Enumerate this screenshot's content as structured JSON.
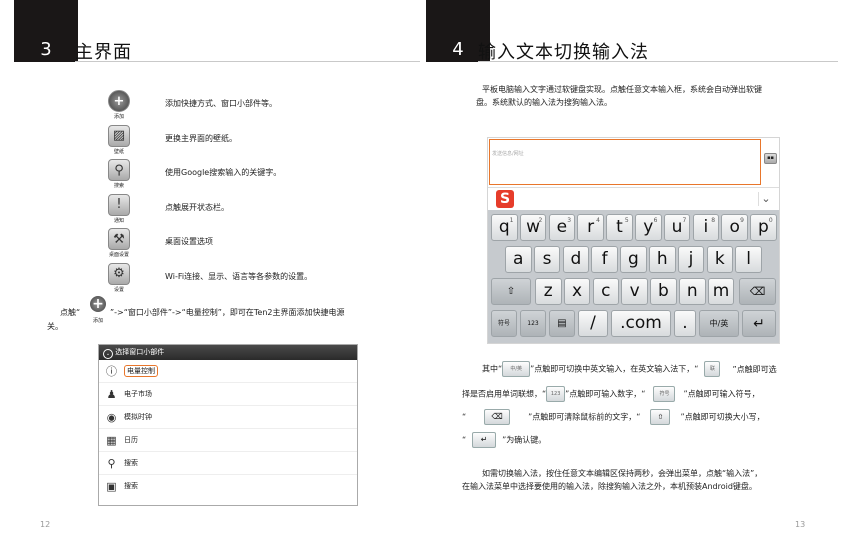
{
  "left": {
    "page_num": "3",
    "title": "主界面",
    "items": [
      {
        "icon": "add-icon",
        "label": "添加",
        "desc": "添加快捷方式、窗口小部件等。"
      },
      {
        "icon": "wallpaper-icon",
        "label": "壁纸",
        "desc": "更换主界面的壁纸。"
      },
      {
        "icon": "search-icon",
        "label": "搜索",
        "desc": "使用Google搜索输入的关键字。"
      },
      {
        "icon": "notification-icon",
        "label": "通知",
        "desc": "点触展开状态栏。"
      },
      {
        "icon": "tools-icon",
        "label": "桌面设置",
        "desc": "桌面设置选项"
      },
      {
        "icon": "gear-icon",
        "label": "设置",
        "desc": "Wi-Fi连接、显示、语言等各参数的设置。"
      }
    ],
    "note_prefix": "点触“",
    "note_icon_label": "添加",
    "note_suffix": "”->“窗口小部件”->“电量控制”，即可在Ten2主界面添加快捷电源",
    "note_line2": "关。",
    "widget": {
      "header": "选择窗口小部件",
      "items": [
        "电量控制",
        "电子市场",
        "模拟时钟",
        "日历",
        "搜索",
        "搜索"
      ]
    },
    "footer": "12"
  },
  "right": {
    "page_num": "4",
    "title": "输入文本切换输入法",
    "intro_1": "平板电脑输入文字通过软键盘实现。点触任意文本输入框，系统会自动弹出软键",
    "intro_2": "盘。系统默认的输入法为搜狗输入法。",
    "kb": {
      "placeholder": "发送信息/网址",
      "ime_logo": "S",
      "row1": [
        "q",
        "w",
        "e",
        "r",
        "t",
        "y",
        "u",
        "i",
        "o",
        "p"
      ],
      "row1_hints": [
        "1",
        "2",
        "3",
        "4",
        "5",
        "6",
        "7",
        "8",
        "9",
        "0"
      ],
      "row2": [
        "a",
        "s",
        "d",
        "f",
        "g",
        "h",
        "j",
        "k",
        "l"
      ],
      "row3": [
        "z",
        "x",
        "c",
        "v",
        "b",
        "n",
        "m"
      ],
      "sym_key": "符号",
      "num_key": "123",
      "slash_key": "/",
      "com_key": ".com",
      "dot_key": ".",
      "lang_key": "中/英",
      "shift_hint": "中/英"
    },
    "p1_a": "其中“",
    "p1_b": "”点触即可切换中英文输入，在英文输入法下，“",
    "p1_c": "”点触即可选",
    "p2_a": "择是否启用单词联想，“",
    "p2_b": "”点触即可输入数字，“",
    "p2_c": "”点触即可输入符号，",
    "p3_a": "“",
    "p3_b": "”点触即可清除鼠标前的文字，“",
    "p3_c": "”点触即可切换大小写，",
    "p4_a": "“",
    "p4_b": "”为确认键。",
    "mini_lang": "中/英",
    "mini_num": "123",
    "mini_sym": "符号",
    "outro_1": "如需切换输入法，按住任意文本编辑区保持两秒，会弹出菜单，点触“输入法”，",
    "outro_2": "在输入法菜单中选择要使用的输入法，除搜狗输入法之外，本机预装Android键盘。",
    "footer": "13"
  },
  "colors": {
    "accent_orange": "#e8762b",
    "kb_bg": "#c6cace",
    "header_dark": "#1a1717"
  }
}
